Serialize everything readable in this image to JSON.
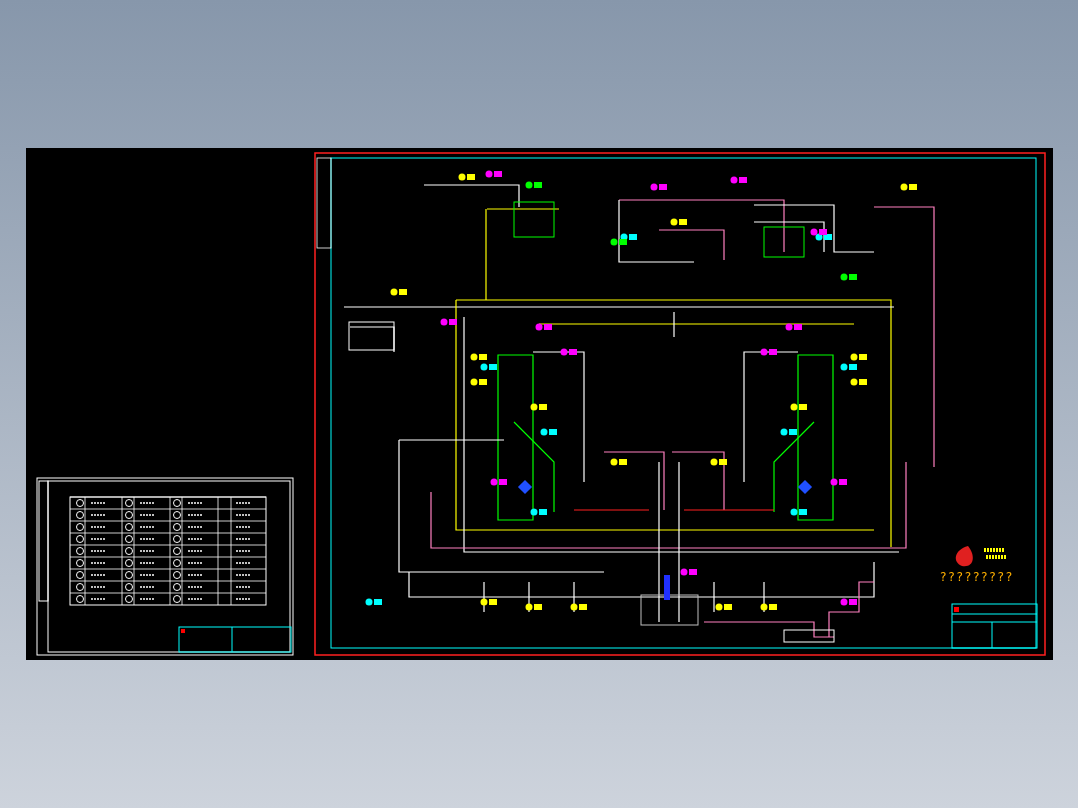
{
  "drawing": {
    "caption": "?????????"
  }
}
